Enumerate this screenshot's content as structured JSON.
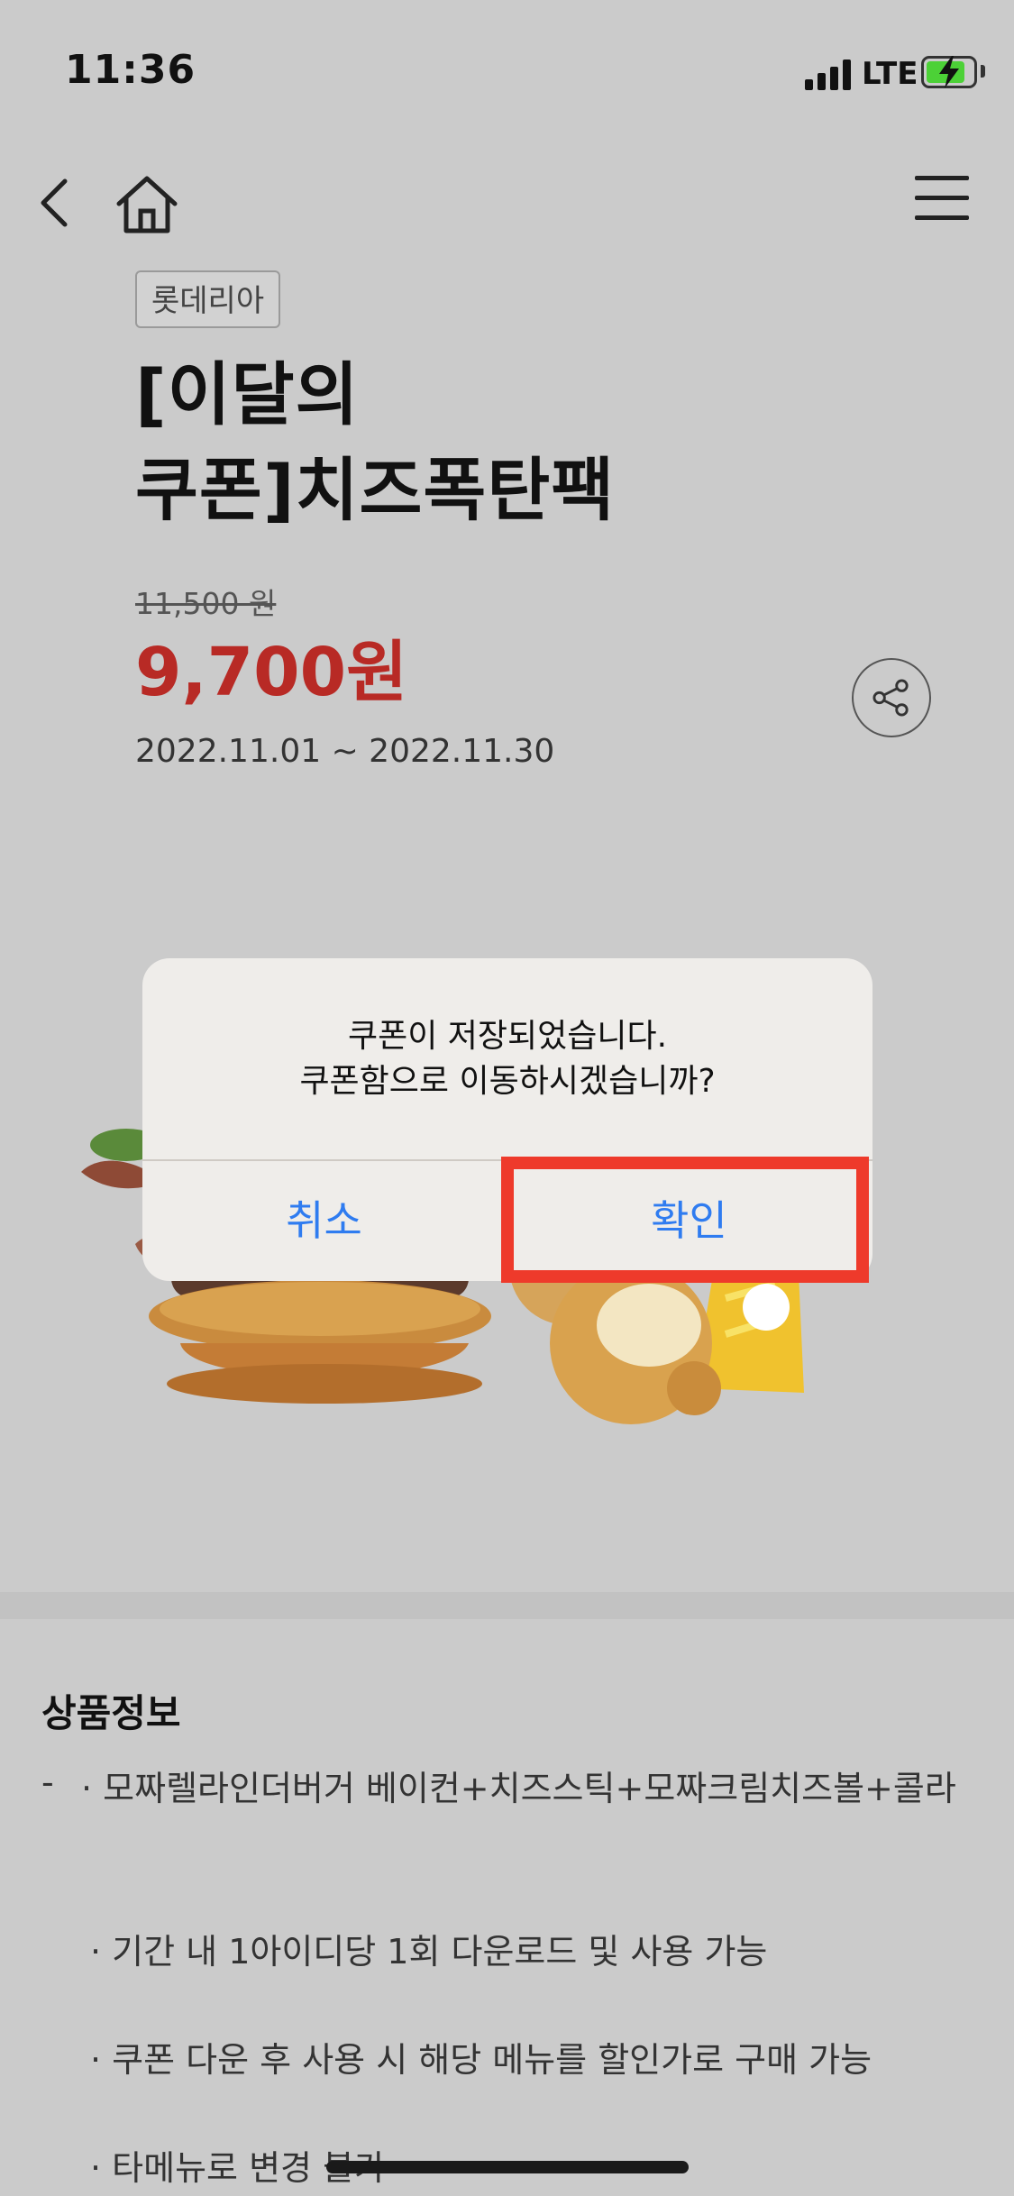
{
  "status_bar": {
    "time": "11:36",
    "network": "LTE"
  },
  "nav": {
    "back_icon": "chevron-left-icon",
    "home_icon": "home-icon",
    "menu_icon": "hamburger-menu-icon"
  },
  "product": {
    "brand": "롯데리아",
    "title_line1": "[이달의",
    "title_line2": "쿠폰]치즈폭탄팩",
    "original_price": "11,500 원",
    "sale_price": "9,700원",
    "period": "2022.11.01 ~ 2022.11.30",
    "share_icon": "share-icon"
  },
  "info": {
    "title": "상품정보",
    "dash": "-",
    "lines": [
      "· 모짜렐라인더버거 베이컨+치즈스틱+모짜크림치즈볼+콜라",
      "· 기간 내 1아이디당 1회 다운로드 및 사용 가능",
      "· 쿠폰 다운 후 사용 시 해당 메뉴를 할인가로 구매 가능",
      "· 타메뉴로 변경 불가"
    ]
  },
  "dialog": {
    "message_line1": "쿠폰이 저장되었습니다.",
    "message_line2": "쿠폰함으로 이동하시겠습니까?",
    "cancel_label": "취소",
    "confirm_label": "확인"
  },
  "colors": {
    "sale_price": "#b82a25",
    "dialog_button": "#2f7cf0",
    "highlight_box": "#ee3a2b",
    "dim_background": "#cbcbcb"
  }
}
